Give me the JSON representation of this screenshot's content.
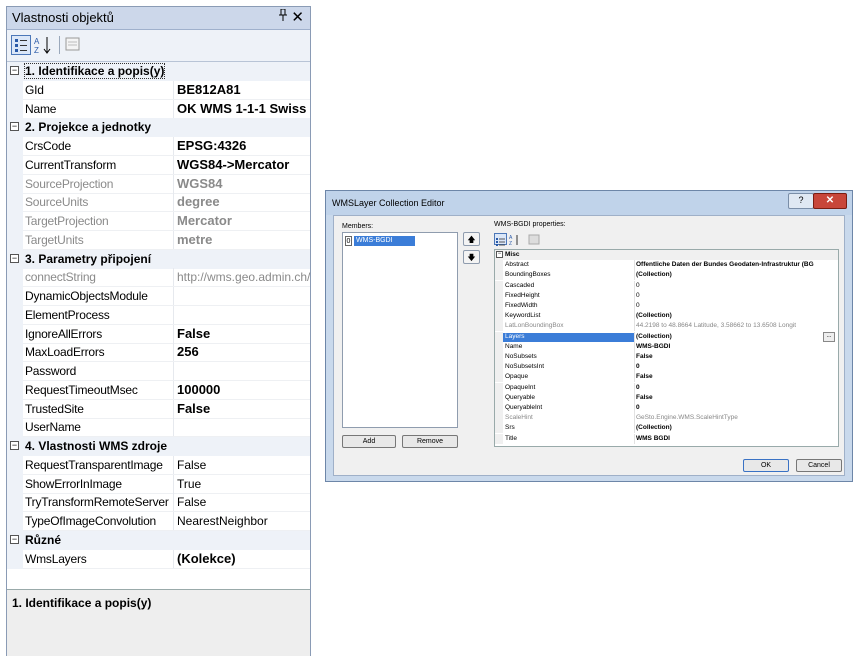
{
  "panel": {
    "title": "Vlastnosti objektů",
    "pin_icon": "pin-icon",
    "close_icon": "close-icon",
    "toolbar": [
      "categorized-icon",
      "alphabetical-icon",
      "property-pages-icon"
    ],
    "categories": [
      {
        "title": "1. Identifikace a popis(y)",
        "rows": [
          {
            "name": "GId",
            "value": "BE812A81",
            "bold": true
          },
          {
            "name": "Name",
            "value": "OK WMS 1-1-1 Swiss",
            "bold": true
          }
        ]
      },
      {
        "title": "2. Projekce a jednotky",
        "rows": [
          {
            "name": "CrsCode",
            "value": "EPSG:4326",
            "bold": true
          },
          {
            "name": "CurrentTransform",
            "value": "WGS84->Mercator",
            "bold": true
          },
          {
            "name": "SourceProjection",
            "value": "WGS84",
            "bold": true,
            "readonly": true
          },
          {
            "name": "SourceUnits",
            "value": "degree",
            "bold": true,
            "readonly": true
          },
          {
            "name": "TargetProjection",
            "value": "Mercator",
            "bold": true,
            "readonly": true
          },
          {
            "name": "TargetUnits",
            "value": "metre",
            "bold": true,
            "readonly": true
          }
        ]
      },
      {
        "title": "3. Parametry připojení",
        "rows": [
          {
            "name": "connectString",
            "value": "http://wms.geo.admin.ch/",
            "bold": false,
            "readonly": true
          },
          {
            "name": "DynamicObjectsModule",
            "value": "",
            "bold": false
          },
          {
            "name": "ElementProcess",
            "value": "",
            "bold": false
          },
          {
            "name": "IgnoreAllErrors",
            "value": "False",
            "bold": true
          },
          {
            "name": "MaxLoadErrors",
            "value": "256",
            "bold": true
          },
          {
            "name": "Password",
            "value": "",
            "bold": false
          },
          {
            "name": "RequestTimeoutMsec",
            "value": "100000",
            "bold": true
          },
          {
            "name": "TrustedSite",
            "value": "False",
            "bold": true
          },
          {
            "name": "UserName",
            "value": "",
            "bold": false
          }
        ]
      },
      {
        "title": "4. Vlastnosti WMS zdroje",
        "rows": [
          {
            "name": "RequestTransparentImage",
            "value": "False",
            "bold": false
          },
          {
            "name": "ShowErrorInImage",
            "value": "True",
            "bold": false
          },
          {
            "name": "TryTransformRemoteServer",
            "value": "False",
            "bold": false
          },
          {
            "name": "TypeOfImageConvolution",
            "value": "NearestNeighbor",
            "bold": false
          }
        ]
      },
      {
        "title": "Různé",
        "rows": [
          {
            "name": "WmsLayers",
            "value": "(Kolekce)",
            "bold": true
          }
        ]
      }
    ],
    "description_title": "1. Identifikace a popis(y)"
  },
  "dialog": {
    "title": "WMSLayer Collection Editor",
    "help_label": "?",
    "close_label": "✕",
    "members_label": "Members:",
    "members": [
      {
        "index": "0",
        "name": "WMS-BGDI"
      }
    ],
    "up_icon": "arrow-up-icon",
    "down_icon": "arrow-down-icon",
    "add_label": "Add",
    "remove_label": "Remove",
    "properties_label": "WMS-BGDI properties:",
    "category": "Misc",
    "properties": [
      {
        "name": "Abstract",
        "value": "Öffentliche Daten der Bundes Geodaten-Infrastruktur (BG",
        "bold": true
      },
      {
        "name": "BoundingBoxes",
        "value": "(Collection)",
        "bold": true
      },
      {
        "name": "Cascaded",
        "value": "0",
        "bold": false
      },
      {
        "name": "FixedHeight",
        "value": "0",
        "bold": false
      },
      {
        "name": "FixedWidth",
        "value": "0",
        "bold": false
      },
      {
        "name": "KeywordList",
        "value": "(Collection)",
        "bold": true
      },
      {
        "name": "LatLonBoundingBox",
        "value": "44.2198 to 48.8664 Latitude, 3.58662 to 13.6508 Longit",
        "bold": false,
        "readonly": true
      },
      {
        "name": "Layers",
        "value": "(Collection)",
        "bold": true,
        "selected": true
      },
      {
        "name": "Name",
        "value": "WMS-BGDI",
        "bold": true
      },
      {
        "name": "NoSubsets",
        "value": "False",
        "bold": true
      },
      {
        "name": "NoSubsetsInt",
        "value": "0",
        "bold": true
      },
      {
        "name": "Opaque",
        "value": "False",
        "bold": true
      },
      {
        "name": "OpaqueInt",
        "value": "0",
        "bold": true
      },
      {
        "name": "Queryable",
        "value": "False",
        "bold": true
      },
      {
        "name": "QueryableInt",
        "value": "0",
        "bold": true
      },
      {
        "name": "ScaleHint",
        "value": "GeSto.Engine.WMS.ScaleHintType",
        "bold": false,
        "readonly": true
      },
      {
        "name": "Srs",
        "value": "(Collection)",
        "bold": true
      },
      {
        "name": "Title",
        "value": "WMS BGDI",
        "bold": true
      }
    ],
    "ok_label": "OK",
    "cancel_label": "Cancel"
  }
}
